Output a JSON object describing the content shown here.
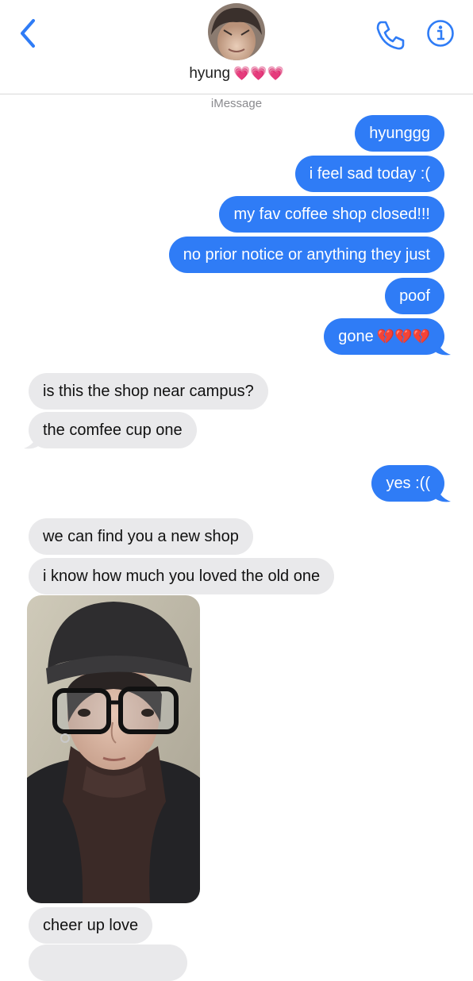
{
  "header": {
    "contact_name": "hyung",
    "contact_hearts": "💗💗💗",
    "service": "iMessage"
  },
  "colors": {
    "sent_bubble": "#2f7cf6",
    "received_bubble": "#e9e9eb",
    "accent": "#2f7cf6"
  },
  "icons": [
    "back-chevron-icon",
    "phone-icon",
    "info-icon"
  ],
  "messages": [
    {
      "from": "me",
      "text": "hyunggg"
    },
    {
      "from": "me",
      "text": "i feel sad today :("
    },
    {
      "from": "me",
      "text": "my fav coffee shop closed!!!"
    },
    {
      "from": "me",
      "text": "no prior notice or anything they just"
    },
    {
      "from": "me",
      "text": "poof"
    },
    {
      "from": "me",
      "text": "gone",
      "emoji": "💔💔💔"
    },
    {
      "from": "them",
      "text": "is this the shop near campus?"
    },
    {
      "from": "them",
      "text": "the comfee cup one"
    },
    {
      "from": "me",
      "text": "yes :(("
    },
    {
      "from": "them",
      "text": "we can find you a new shop"
    },
    {
      "from": "them",
      "text": "i know how much you loved the old one"
    },
    {
      "from": "them",
      "type": "photo"
    },
    {
      "from": "them",
      "text": "cheer up love"
    }
  ]
}
